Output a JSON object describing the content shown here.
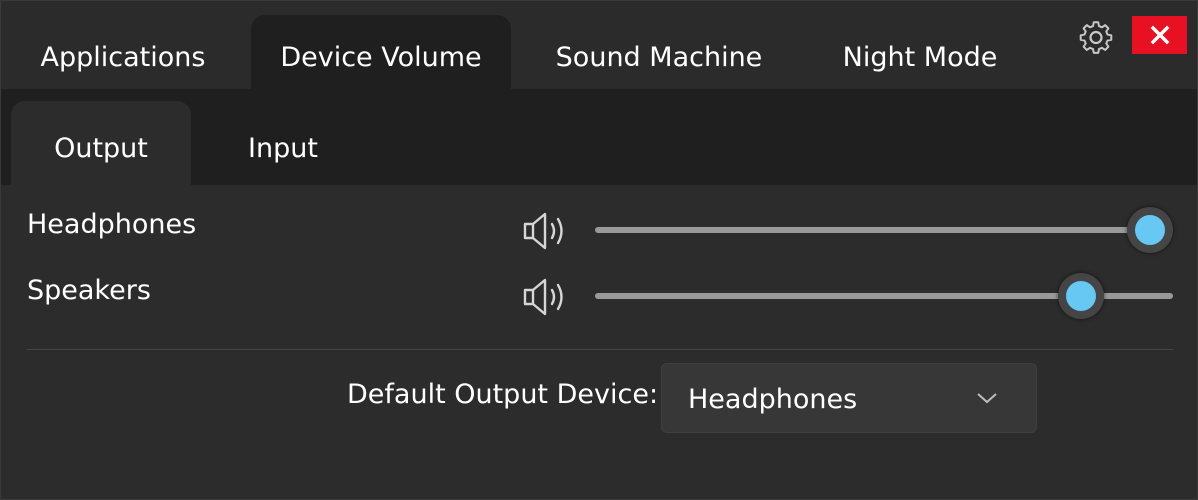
{
  "tabs": [
    {
      "label": "Applications",
      "active": false
    },
    {
      "label": "Device Volume",
      "active": true
    },
    {
      "label": "Sound Machine",
      "active": false
    },
    {
      "label": "Night Mode",
      "active": false
    }
  ],
  "window_controls": {
    "settings_icon": "gear-icon",
    "close_icon": "close-icon"
  },
  "sub_tabs": [
    {
      "label": "Output",
      "active": true
    },
    {
      "label": "Input",
      "active": false
    }
  ],
  "devices": [
    {
      "name": "Headphones",
      "volume": 0.96,
      "icon": "speaker-icon"
    },
    {
      "name": "Speakers",
      "volume": 0.84,
      "icon": "speaker-icon"
    }
  ],
  "default_output": {
    "label": "Default Output Device:",
    "value": "Headphones",
    "icon": "chevron-down-icon"
  },
  "colors": {
    "accent": "#66c8f3",
    "close_button": "#e81123",
    "background": "#2b2b2b",
    "panel": "#1f1f1f"
  }
}
